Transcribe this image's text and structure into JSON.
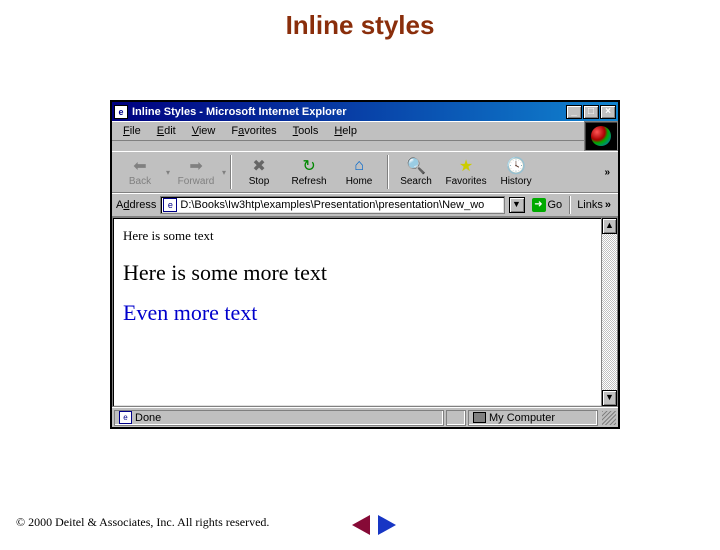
{
  "slide": {
    "title": "Inline styles"
  },
  "window": {
    "title": "Inline Styles - Microsoft Internet Explorer"
  },
  "menu": {
    "file": "File",
    "edit": "Edit",
    "view": "View",
    "favorites": "Favorites",
    "tools": "Tools",
    "help": "Help"
  },
  "toolbar": {
    "back": "Back",
    "forward": "Forward",
    "stop": "Stop",
    "refresh": "Refresh",
    "home": "Home",
    "search": "Search",
    "favorites": "Favorites",
    "history": "History",
    "more": "»"
  },
  "address": {
    "label": "Address",
    "value": "D:\\Books\\Iw3htp\\examples\\Presentation\\presentation\\New_wo",
    "go": "Go",
    "links": "Links",
    "links_more": "»"
  },
  "page": {
    "line1": "Here is some text",
    "line2": "Here is some more text",
    "line3": "Even more text"
  },
  "status": {
    "done": "Done",
    "zone": "My Computer"
  },
  "footer": {
    "copyright": "© 2000 Deitel & Associates, Inc.  All rights reserved."
  }
}
